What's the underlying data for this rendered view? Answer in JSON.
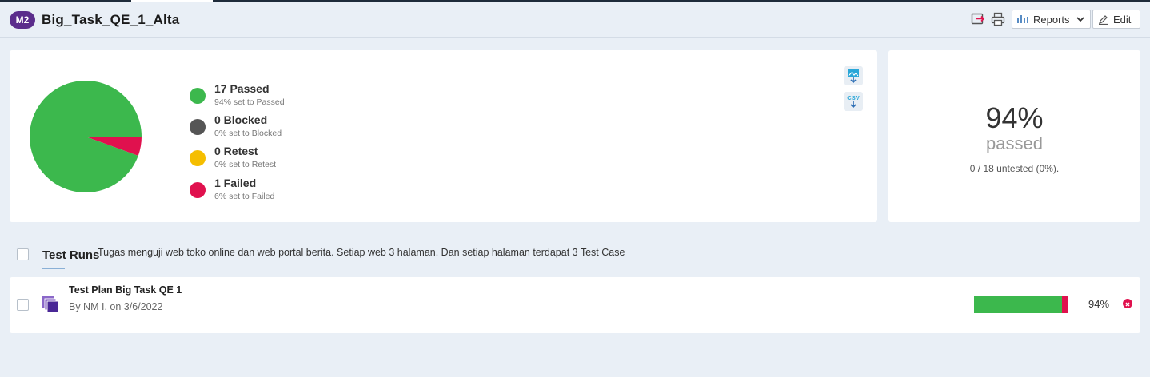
{
  "header": {
    "badge": "M2",
    "title": "Big_Task_QE_1_Alta",
    "reports_label": "Reports",
    "edit_label": "Edit"
  },
  "summary": {
    "legend": [
      {
        "title": "17 Passed",
        "sub": "94% set to Passed",
        "color": "#3cb84d"
      },
      {
        "title": "0 Blocked",
        "sub": "0% set to Blocked",
        "color": "#555555"
      },
      {
        "title": "0 Retest",
        "sub": "0% set to Retest",
        "color": "#f5be00"
      },
      {
        "title": "1 Failed",
        "sub": "6% set to Failed",
        "color": "#e0114e"
      }
    ],
    "csv_label": "CSV",
    "percent": "94%",
    "percent_label": "passed",
    "untested": "0 / 18 untested (0%)."
  },
  "chart_data": {
    "type": "pie",
    "slices": [
      {
        "label": "Passed",
        "value": 17,
        "color": "#3cb84d"
      },
      {
        "label": "Blocked",
        "value": 0,
        "color": "#555555"
      },
      {
        "label": "Retest",
        "value": 0,
        "color": "#f5be00"
      },
      {
        "label": "Failed",
        "value": 1,
        "color": "#e0114e"
      }
    ]
  },
  "runs": {
    "title": "Test Runs",
    "description": "Tugas menguji web toko online dan web portal berita. Setiap web 3 halaman. Dan setiap halaman terdapat 3 Test Case",
    "items": [
      {
        "title": "Test Plan Big Task QE 1",
        "meta": "By NM I. on 3/6/2022",
        "percent": "94%",
        "passed_fraction": 0.94,
        "failed_fraction": 0.06
      }
    ]
  }
}
